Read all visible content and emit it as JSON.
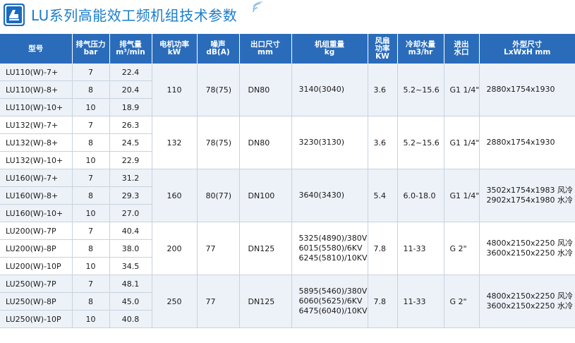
{
  "title": "LU系列高能效工频机组技术参数",
  "headers": [
    [
      "型号"
    ],
    [
      "排气压力",
      "bar"
    ],
    [
      "排气量",
      "m³/min"
    ],
    [
      "电机功率",
      "kW"
    ],
    [
      "噪声",
      "dB(A)"
    ],
    [
      "出口尺寸",
      "mm"
    ],
    [
      "机组重量",
      "kg"
    ],
    [
      "风扇",
      "功率",
      "KW"
    ],
    [
      "冷却水量",
      "m3/hr"
    ],
    [
      "进出",
      "水口"
    ],
    [
      "外型尺寸",
      "LxWxH mm"
    ]
  ],
  "groups": [
    {
      "rows": [
        {
          "model": "LU110(W)-7+",
          "pressure": "7",
          "flow": "22.4"
        },
        {
          "model": "LU110(W)-8+",
          "pressure": "8",
          "flow": "20.4"
        },
        {
          "model": "LU110(W)-10+",
          "pressure": "10",
          "flow": "18.9"
        }
      ],
      "power": "110",
      "noise": "78(75)",
      "outlet": "DN80",
      "weight": [
        "3140(3040)"
      ],
      "fan": "3.6",
      "water": "5.2~15.6",
      "port": "G1 1/4\"",
      "dims": [
        "2880x1754x1930"
      ]
    },
    {
      "rows": [
        {
          "model": "LU132(W)-7+",
          "pressure": "7",
          "flow": "26.3"
        },
        {
          "model": "LU132(W)-8+",
          "pressure": "8",
          "flow": "24.5"
        },
        {
          "model": "LU132(W)-10+",
          "pressure": "10",
          "flow": "22.9"
        }
      ],
      "power": "132",
      "noise": "78(75)",
      "outlet": "DN80",
      "weight": [
        "3230(3130)"
      ],
      "fan": "3.6",
      "water": "5.2~15.6",
      "port": "G1 1/4\"",
      "dims": [
        "2880x1754x1930"
      ]
    },
    {
      "rows": [
        {
          "model": "LU160(W)-7+",
          "pressure": "7",
          "flow": "31.2"
        },
        {
          "model": "LU160(W)-8+",
          "pressure": "8",
          "flow": "29.3"
        },
        {
          "model": "LU160(W)-10+",
          "pressure": "10",
          "flow": "27.0"
        }
      ],
      "power": "160",
      "noise": "80(77)",
      "outlet": "DN100",
      "weight": [
        "3640(3430)"
      ],
      "fan": "5.4",
      "water": "6.0-18.0",
      "port": "G1 1/4\"",
      "dims": [
        "3502x1754x1983 风冷",
        "2902x1754x1980 水冷"
      ]
    },
    {
      "rows": [
        {
          "model": "LU200(W)-7P",
          "pressure": "7",
          "flow": "40.4"
        },
        {
          "model": "LU200(W)-8P",
          "pressure": "8",
          "flow": "38.0"
        },
        {
          "model": "LU200(W)-10P",
          "pressure": "10",
          "flow": "34.5"
        }
      ],
      "power": "200",
      "noise": "77",
      "outlet": "DN125",
      "weight": [
        "5325(4890)/380V",
        "6015(5580)/6KV",
        "6245(5810)/10KV"
      ],
      "fan": "7.8",
      "water": "11-33",
      "port": "G 2\"",
      "dims": [
        "4800x2150x2250 风冷",
        "3600x2150x2250 水冷"
      ]
    },
    {
      "rows": [
        {
          "model": "LU250(W)-7P",
          "pressure": "7",
          "flow": "48.1"
        },
        {
          "model": "LU250(W)-8P",
          "pressure": "8",
          "flow": "45.0"
        },
        {
          "model": "LU250(W)-10P",
          "pressure": "10",
          "flow": "40.8"
        }
      ],
      "power": "250",
      "noise": "77",
      "outlet": "DN125",
      "weight": [
        "5895(5460)/380V",
        "6060(5625)/6KV",
        "6475(6040)/10KV"
      ],
      "fan": "7.8",
      "water": "11-33",
      "port": "G 2\"",
      "dims": [
        "4800x2150x2250 风冷",
        "3600x2150x2250 水冷"
      ]
    }
  ],
  "colors": {
    "header_bg": "#2a6cba",
    "title_text": "#1a7cc8",
    "shaded_row": "#edf2f8",
    "grid_line": "#c8d2de"
  },
  "icons": {
    "logo": "compressor-logo-icon",
    "signal": "wifi-signal-icon"
  }
}
